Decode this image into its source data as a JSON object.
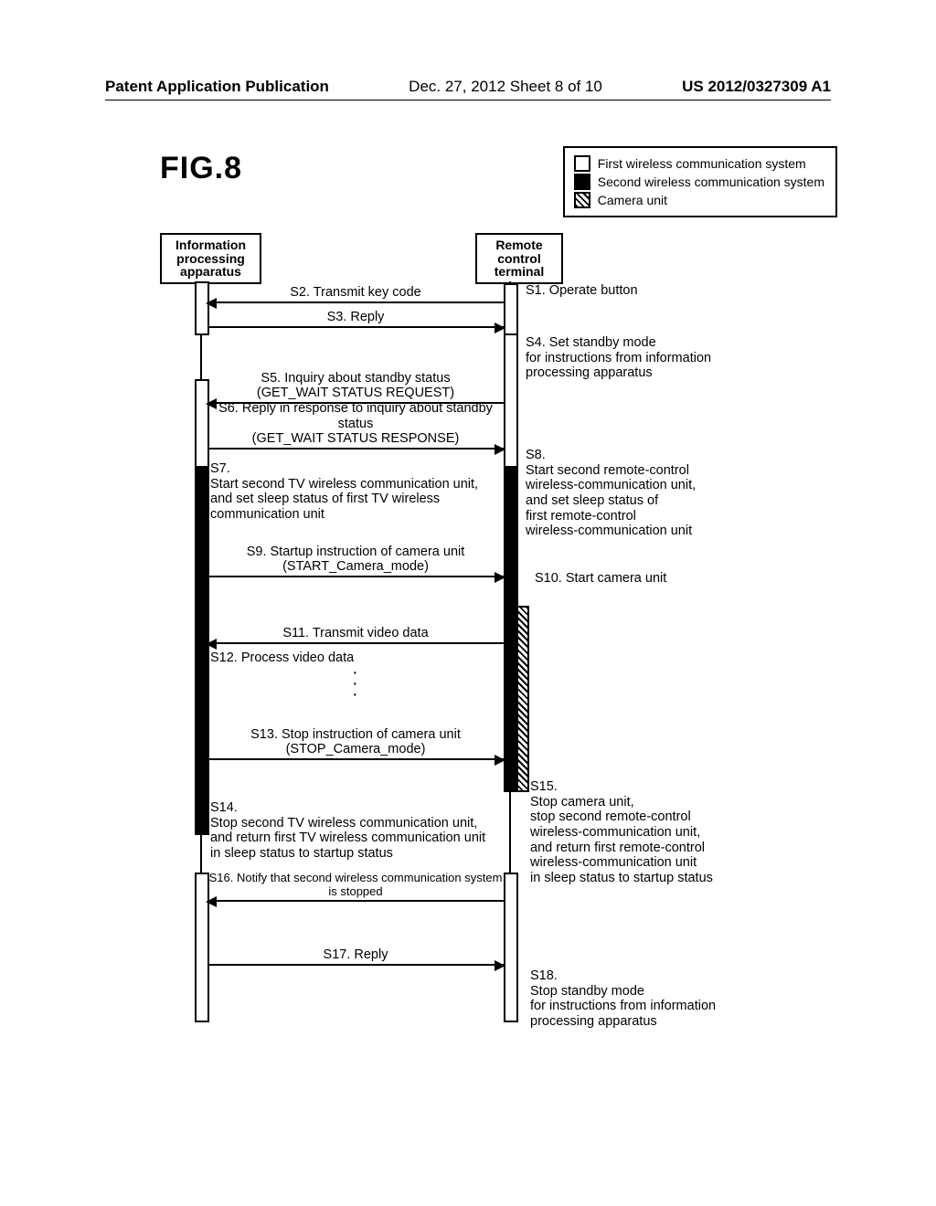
{
  "header": {
    "left": "Patent Application Publication",
    "center": "Dec. 27, 2012  Sheet 8 of 10",
    "right": "US 2012/0327309 A1"
  },
  "figure_label": "FIG.8",
  "legend": {
    "first": "First wireless communication system",
    "second": "Second wireless communication system",
    "camera": "Camera unit"
  },
  "actors": {
    "ipa": "Information\nprocessing\napparatus",
    "rct": "Remote\ncontrol\nterminal"
  },
  "msgs": {
    "s1": "S1. Operate button",
    "s2": "S2. Transmit key code",
    "s3": "S3. Reply",
    "s4": "S4. Set standby mode\nfor instructions from information\nprocessing apparatus",
    "s5": "S5. Inquiry about standby status\n(GET_WAIT STATUS REQUEST)",
    "s6": "S6. Reply in response to inquiry about standby status\n(GET_WAIT STATUS RESPONSE)",
    "s7": "S7.\nStart second TV wireless communication unit,\nand set sleep status of first TV wireless communication unit",
    "s8": "S8.\nStart second remote-control\nwireless-communication unit,\nand set sleep status of\nfirst remote-control\nwireless-communication unit",
    "s9": "S9. Startup instruction of camera unit\n(START_Camera_mode)",
    "s10": "S10. Start camera unit",
    "s11": "S11. Transmit video data",
    "s12": "S12. Process video data",
    "s13": "S13. Stop instruction of camera unit\n(STOP_Camera_mode)",
    "s14": "S14.\nStop second TV wireless communication unit,\nand return first TV wireless communication unit\nin sleep status to startup status",
    "s15": "S15.\nStop camera unit,\nstop second remote-control\nwireless-communication unit,\nand return first remote-control\nwireless-communication unit\nin sleep status to startup status",
    "s16": "S16. Notify that second wireless communication system is stopped",
    "s17": "S17. Reply",
    "s18": "S18.\nStop standby mode\nfor instructions from information\nprocessing apparatus"
  }
}
